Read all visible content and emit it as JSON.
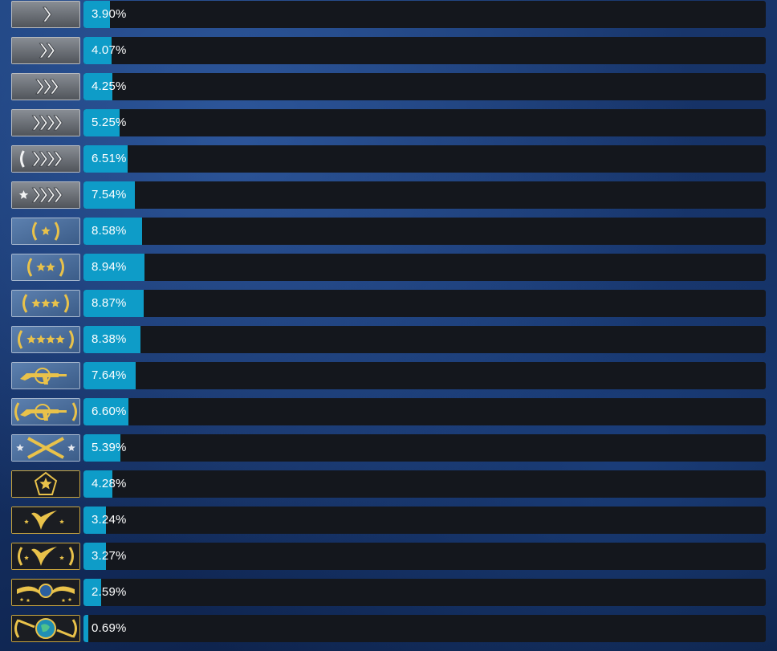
{
  "chart_data": {
    "type": "bar",
    "orientation": "horizontal",
    "categories": [
      "silver-1-icon",
      "silver-2-icon",
      "silver-3-icon",
      "silver-4-icon",
      "silver-elite-icon",
      "silver-elite-master-icon",
      "gold-nova-1-icon",
      "gold-nova-2-icon",
      "gold-nova-3-icon",
      "gold-nova-master-icon",
      "master-guardian-1-icon",
      "master-guardian-2-icon",
      "master-guardian-elite-icon",
      "distinguished-master-guardian-icon",
      "legendary-eagle-icon",
      "legendary-eagle-master-icon",
      "supreme-master-first-class-icon",
      "global-elite-icon"
    ],
    "values": [
      3.9,
      4.07,
      4.25,
      5.25,
      6.51,
      7.54,
      8.58,
      8.94,
      8.87,
      8.38,
      7.64,
      6.6,
      5.39,
      4.28,
      3.24,
      3.27,
      2.59,
      0.69
    ],
    "labels": [
      "3.90%",
      "4.07%",
      "4.25%",
      "5.25%",
      "6.51%",
      "7.54%",
      "8.58%",
      "8.94%",
      "8.87%",
      "8.38%",
      "7.64%",
      "6.60%",
      "5.39%",
      "4.28%",
      "3.24%",
      "3.27%",
      "2.59%",
      "0.69%"
    ],
    "xlim": [
      0,
      100
    ],
    "grid": false,
    "legend": "none",
    "colors": {
      "fill": "#0e9cc8",
      "track": "#14171d",
      "label": "#ffffff",
      "silver_badge": "#6a6f76",
      "nova_badge": "#4b6f9e",
      "gold_emblem": "#e9c24a",
      "dark_badge": "#1b1d22"
    }
  }
}
